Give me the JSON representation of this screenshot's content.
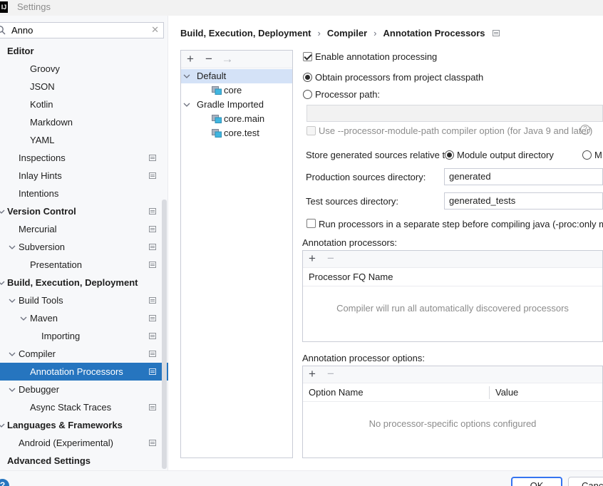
{
  "window": {
    "logo": "IJ",
    "title": "Settings"
  },
  "search": {
    "value": "Anno",
    "clear": "✕"
  },
  "sidebar": {
    "items": [
      {
        "label": "Editor",
        "bold": true
      },
      {
        "label": "Groovy"
      },
      {
        "label": "JSON"
      },
      {
        "label": "Kotlin"
      },
      {
        "label": "Markdown"
      },
      {
        "label": "YAML"
      },
      {
        "label": "Inspections"
      },
      {
        "label": "Inlay Hints"
      },
      {
        "label": "Intentions"
      },
      {
        "label": "Version Control",
        "bold": true
      },
      {
        "label": "Mercurial"
      },
      {
        "label": "Subversion"
      },
      {
        "label": "Presentation"
      },
      {
        "label": "Build, Execution, Deployment",
        "bold": true
      },
      {
        "label": "Build Tools"
      },
      {
        "label": "Maven"
      },
      {
        "label": "Importing"
      },
      {
        "label": "Compiler"
      },
      {
        "label": "Annotation Processors",
        "selected": true
      },
      {
        "label": "Debugger"
      },
      {
        "label": "Async Stack Traces"
      },
      {
        "label": "Languages & Frameworks",
        "bold": true
      },
      {
        "label": "Android (Experimental)"
      },
      {
        "label": "Advanced Settings",
        "bold": true
      }
    ]
  },
  "breadcrumb": {
    "parts": [
      "Build, Execution, Deployment",
      "Compiler",
      "Annotation Processors"
    ],
    "sep": "›"
  },
  "profiles": {
    "toolbar": {
      "add": "+",
      "remove": "−",
      "move": "→"
    },
    "items": [
      {
        "label": "Default"
      },
      {
        "label": "core"
      },
      {
        "label": "Gradle Imported"
      },
      {
        "label": "core.main"
      },
      {
        "label": "core.test"
      }
    ]
  },
  "settings": {
    "enable_processing": "Enable annotation processing",
    "obtain_classpath": "Obtain processors from project classpath",
    "processor_path": "Processor path:",
    "processor_path_value": "",
    "module_path_option": "Use --processor-module-path compiler option (for Java 9 and later)",
    "help_glyph": "?",
    "store_relative": "Store generated sources relative to:",
    "module_output": "Module output directory",
    "module_content_partial": "M",
    "production_dir_label": "Production sources directory:",
    "production_dir_value": "generated",
    "test_dir_label": "Test sources directory:",
    "test_dir_value": "generated_tests",
    "separate_step": "Run processors in a separate step before compiling java (-proc:only mode)"
  },
  "processors_table": {
    "title": "Annotation processors:",
    "add": "+",
    "remove": "−",
    "column": "Processor FQ Name",
    "empty": "Compiler will run all automatically discovered processors"
  },
  "options_table": {
    "title": "Annotation processor options:",
    "add": "+",
    "remove": "−",
    "columns": [
      "Option Name",
      "Value"
    ],
    "empty": "No processor-specific options configured"
  },
  "footer": {
    "help": "?",
    "ok": "OK",
    "cancel": "Cancel"
  },
  "colors": {
    "selection": "#2675bf",
    "profile_selection": "#d4e2f7",
    "accent": "#3574f0"
  }
}
